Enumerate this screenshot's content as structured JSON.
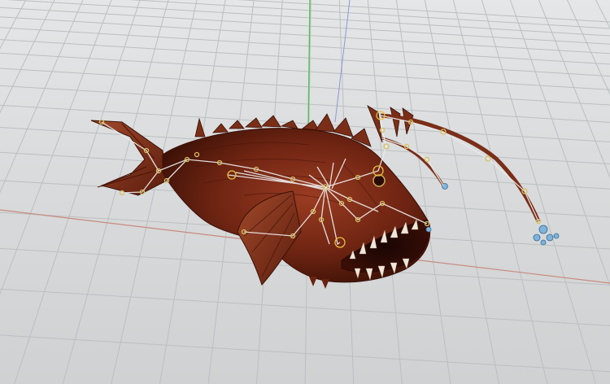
{
  "viewport": {
    "background_color": "#d8dadb",
    "grid_color": "#bcbfc1",
    "x_axis_color": "#c97a6a",
    "y_axis_color": "#5fc15f",
    "z_axis_color": "#7a8fd8"
  },
  "model": {
    "body_color": "#7a2a16",
    "body_dark_color": "#4a1508",
    "fin_color": "#8a3a22",
    "lure_color": "#6fa7d4",
    "rig": {
      "bone_color": "#e6e6e6",
      "joint_color": "#d8c060",
      "selected_joint_color": "#e8c040"
    }
  }
}
